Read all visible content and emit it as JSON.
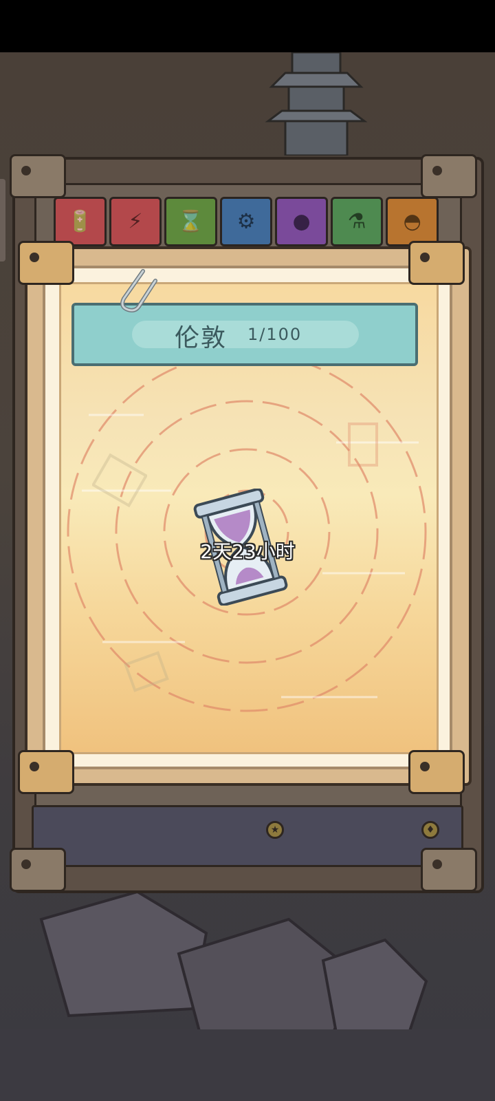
{
  "card": {
    "city_name": "伦敦",
    "progress": "1/100",
    "timer": "2天23小时"
  },
  "tabs": [
    {
      "name": "battery-red",
      "icon": "battery-icon",
      "color": "#b3484b",
      "glyph": "🔋"
    },
    {
      "name": "battery-red-2",
      "icon": "battery-bolt-icon",
      "color": "#b3484b",
      "glyph": "⚡"
    },
    {
      "name": "hourglass-green",
      "icon": "hourglass-icon",
      "color": "#5d8a3c",
      "glyph": "⌛"
    },
    {
      "name": "gear-blue",
      "icon": "gear-icon",
      "color": "#3f6a9a",
      "glyph": "⚙"
    },
    {
      "name": "bomb-purple",
      "icon": "bomb-icon",
      "color": "#7a4a9a",
      "glyph": "●"
    },
    {
      "name": "potion-green",
      "icon": "potion-icon",
      "color": "#4e8a50",
      "glyph": "⚗"
    },
    {
      "name": "ghost-orange",
      "icon": "ghost-icon",
      "color": "#b8742f",
      "glyph": "◓"
    }
  ],
  "colors": {
    "banner": "#8fcfcc",
    "paper": "#f7d9a0"
  }
}
